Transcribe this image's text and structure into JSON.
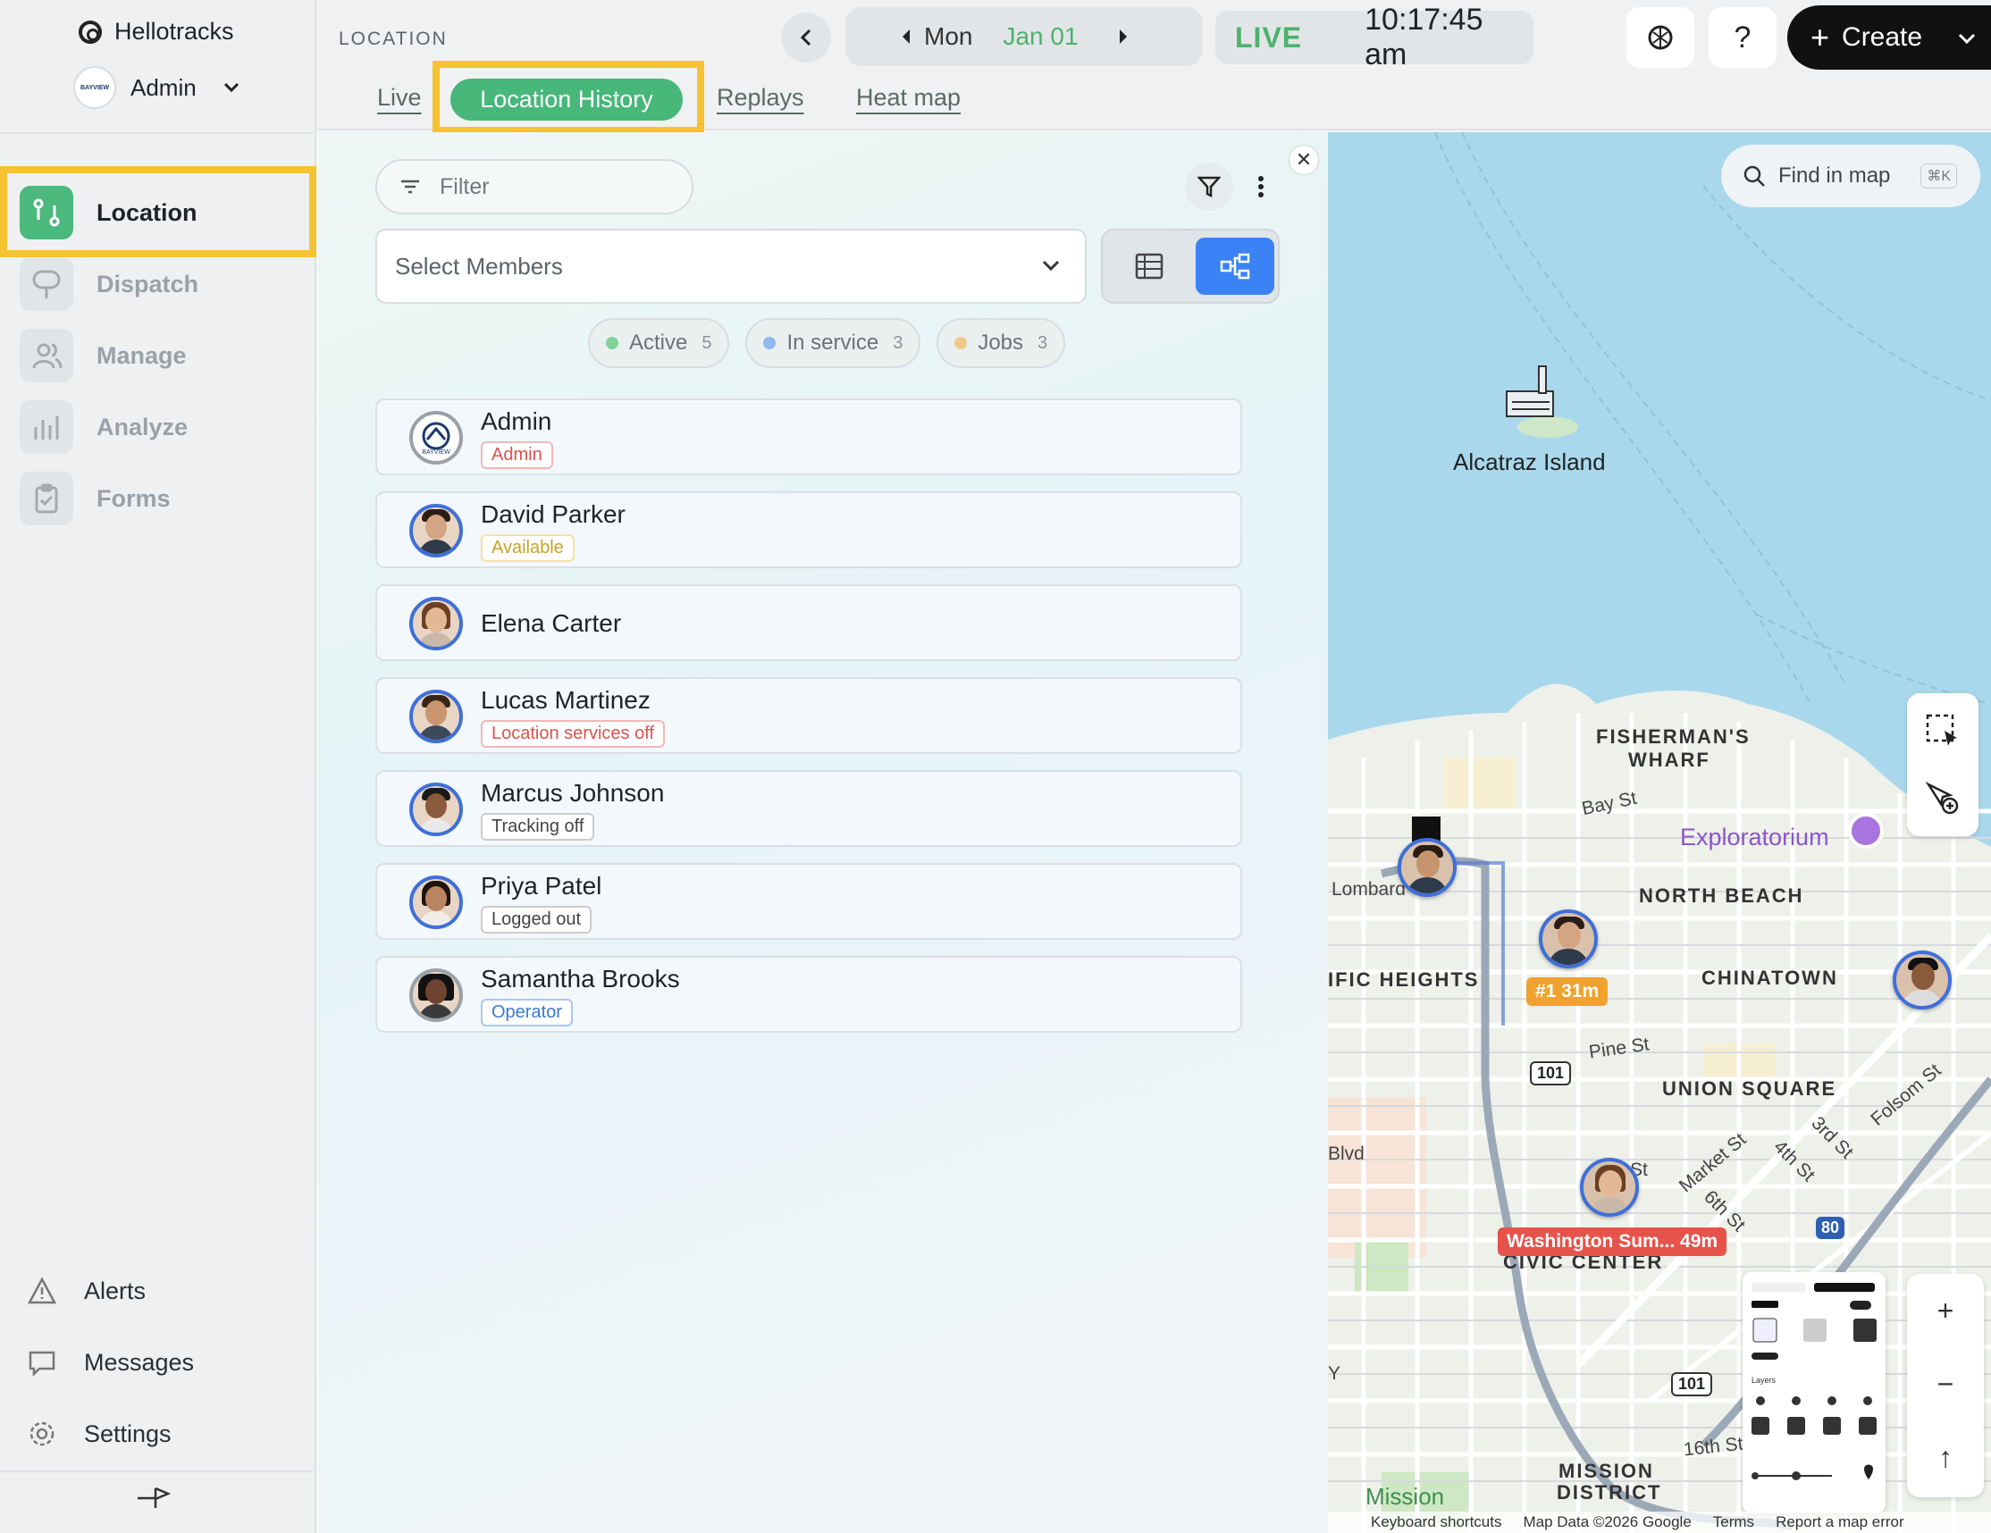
{
  "brand": {
    "name": "Hellotracks"
  },
  "account": {
    "name": "Admin",
    "logo_text": "BAYVIEW"
  },
  "sidebar": {
    "items": [
      {
        "label": "Location",
        "icon": "route-icon",
        "active": true
      },
      {
        "label": "Dispatch",
        "icon": "sign-icon",
        "active": false
      },
      {
        "label": "Manage",
        "icon": "users-icon",
        "active": false
      },
      {
        "label": "Analyze",
        "icon": "chart-icon",
        "active": false
      },
      {
        "label": "Forms",
        "icon": "clipboard-icon",
        "active": false
      }
    ],
    "bottom": [
      {
        "label": "Alerts",
        "icon": "warning-icon"
      },
      {
        "label": "Messages",
        "icon": "chat-icon"
      },
      {
        "label": "Settings",
        "icon": "gear-icon"
      }
    ]
  },
  "header": {
    "section": "LOCATION",
    "tabs": [
      "Live",
      "Location History",
      "Replays",
      "Heat map"
    ],
    "active_tab": "Location History",
    "date_day": "Mon",
    "date_value": "Jan 01",
    "live_label": "LIVE",
    "clock": "10:17:45 am",
    "help_label": "?",
    "create_label": "Create"
  },
  "panel": {
    "filter_placeholder": "Filter",
    "select_members_placeholder": "Select Members",
    "status_pills": [
      {
        "label": "Active",
        "count": "5",
        "color": "#7fd39a"
      },
      {
        "label": "In service",
        "count": "3",
        "color": "#8fb9f0"
      },
      {
        "label": "Jobs",
        "count": "3",
        "color": "#f0c98a"
      }
    ],
    "members": [
      {
        "name": "Admin",
        "badge": "Admin",
        "badge_color": "#d9534f",
        "avatar": "logo"
      },
      {
        "name": "David Parker",
        "badge": "Available",
        "badge_color": "#c9a227"
      },
      {
        "name": "Elena Carter",
        "badge": ""
      },
      {
        "name": "Lucas Martinez",
        "badge": "Location services off",
        "badge_color": "#d9534f"
      },
      {
        "name": "Marcus Johnson",
        "badge": "Tracking off",
        "badge_color": "#555555"
      },
      {
        "name": "Priya Patel",
        "badge": "Logged out",
        "badge_color": "#555555"
      },
      {
        "name": "Samantha Brooks",
        "badge": "Operator",
        "badge_color": "#3a7bd5"
      }
    ]
  },
  "map": {
    "search_placeholder": "Find in map",
    "search_shortcut": "⌘K",
    "landmarks": [
      "Alcatraz Island",
      "Exploratorium"
    ],
    "districts": [
      "FISHERMAN'S",
      "WHARF",
      "NORTH BEACH",
      "CHINATOWN",
      "UNION SQUARE",
      "IFIC HEIGHTS",
      "MISSION",
      "DISTRICT",
      "CIVIC CENTER"
    ],
    "streets": [
      "Bay St",
      "Lombard",
      "Pine St",
      "Market St",
      "4th St",
      "3rd St",
      "Folsom St",
      "6th St",
      "Blvd",
      "16th St",
      "St",
      "Y",
      "Mission"
    ],
    "highways": [
      "101",
      "80",
      "101"
    ],
    "tags": [
      {
        "label": "#1 31m",
        "color": "#f0a22e"
      },
      {
        "label": "Washington Sum... 49m",
        "color": "#e5534b"
      }
    ],
    "footer": [
      "Keyboard shortcuts",
      "Map Data ©2026 Google",
      "Terms",
      "Report a map error"
    ],
    "zoom_in": "+",
    "zoom_out": "−",
    "compass": "↑"
  }
}
